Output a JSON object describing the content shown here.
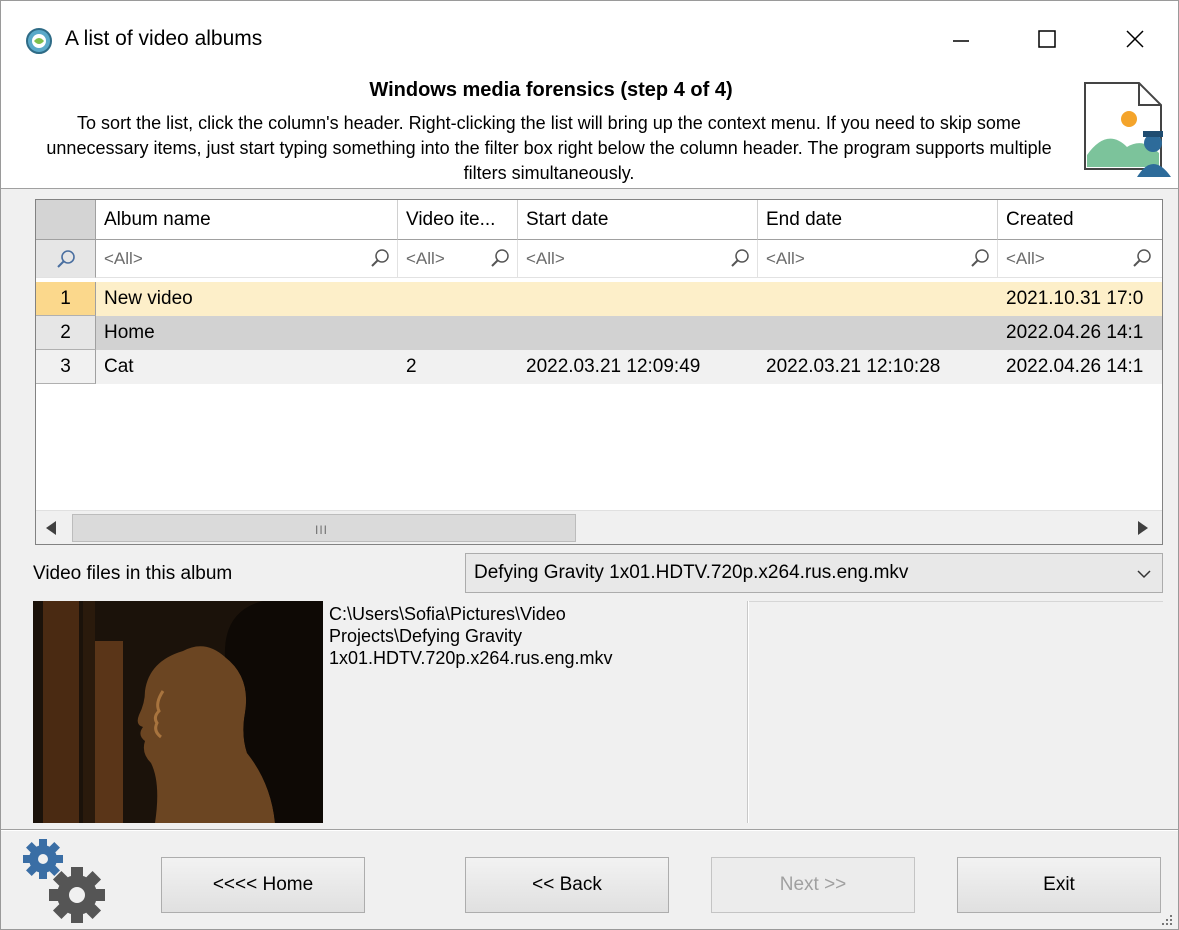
{
  "window": {
    "title": "A list of video albums",
    "minimize_glyph": "—",
    "maximize_glyph": "☐",
    "close_glyph": "✕"
  },
  "header": {
    "step_title": "Windows media forensics (step 4 of 4)",
    "description": "To sort the list, click the column's header. Right-clicking the list will bring up the context menu. If you need to skip some unnecessary items, just start typing something into the filter box right below the column header. The program supports multiple filters simultaneously."
  },
  "grid": {
    "columns": [
      "Album name",
      "Video ite...",
      "Start date",
      "End date",
      "Created"
    ],
    "filter_placeholder": "<All>",
    "rows": [
      {
        "num": "1",
        "album": "New video",
        "items": "",
        "start": "",
        "end": "",
        "created": "2021.10.31 17:0"
      },
      {
        "num": "2",
        "album": "Home",
        "items": "",
        "start": "",
        "end": "",
        "created": "2022.04.26 14:1"
      },
      {
        "num": "3",
        "album": "Cat",
        "items": "2",
        "start": "2022.03.21 12:09:49",
        "end": "2022.03.21 12:10:28",
        "created": "2022.04.26 14:1"
      }
    ],
    "scroll_grip": "III"
  },
  "video": {
    "label": "Video files in this album",
    "selected_file": "Defying Gravity 1x01.HDTV.720p.x264.rus.eng.mkv",
    "path_line1": "C:\\Users\\Sofia\\Pictures\\Video",
    "path_line2": "Projects\\Defying Gravity",
    "path_line3": "1x01.HDTV.720p.x264.rus.eng.mkv"
  },
  "footer": {
    "home_label": "<<<< Home",
    "back_label": "<< Back",
    "next_label": "Next >>",
    "exit_label": "Exit"
  },
  "colors": {
    "selected_row": "#fdefc9",
    "selected_indicator": "#fbd88c",
    "secondary_row": "#d2d2d2"
  }
}
